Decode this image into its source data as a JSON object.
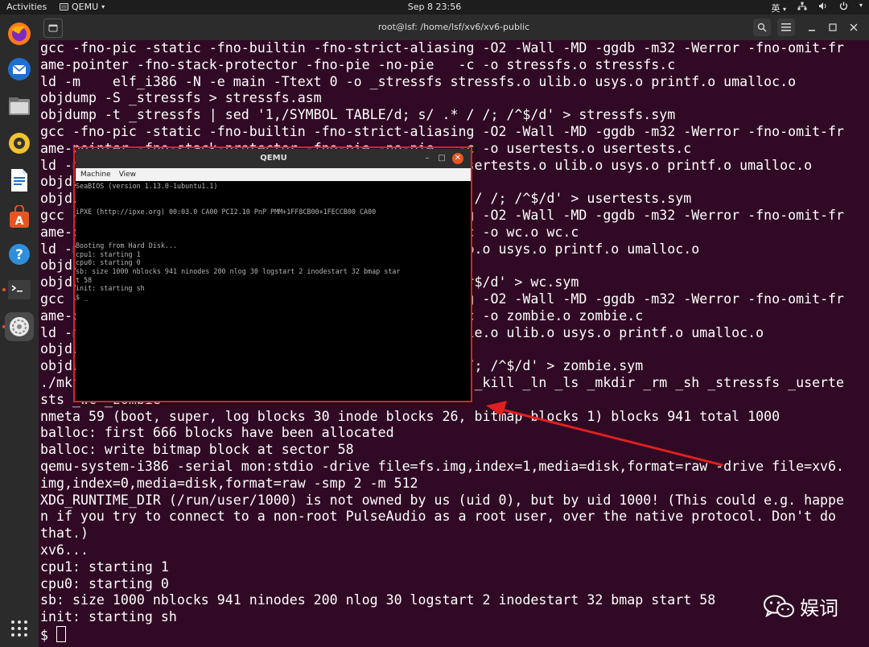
{
  "topbar": {
    "activities": "Activities",
    "app_name": "QEMU",
    "clock": "Sep 8  23:56",
    "input_method": "英"
  },
  "terminal": {
    "title": "root@lsf: /home/lsf/xv6/xv6-public",
    "lines": [
      "gcc -fno-pic -static -fno-builtin -fno-strict-aliasing -O2 -Wall -MD -ggdb -m32 -Werror -fno-omit-fr",
      "ame-pointer -fno-stack-protector -fno-pie -no-pie   -c -o stressfs.o stressfs.c",
      "ld -m    elf_i386 -N -e main -Ttext 0 -o _stressfs stressfs.o ulib.o usys.o printf.o umalloc.o",
      "objdump -S _stressfs > stressfs.asm",
      "objdump -t _stressfs | sed '1,/SYMBOL TABLE/d; s/ .* / /; /^$/d' > stressfs.sym",
      "gcc -fno-pic -static -fno-builtin -fno-strict-aliasing -O2 -Wall -MD -ggdb -m32 -Werror -fno-omit-fr",
      "ame-pointer -fno-stack-protector -fno-pie -no-pie   -c -o usertests.o usertests.c",
      "ld -m    elf_i386 -N -e main -Ttext 0 -o _usertests usertests.o ulib.o usys.o printf.o umalloc.o",
      "objdump -S _usertests > usertests.asm",
      "objdump -t _usertests | sed '1,/SYMBOL TABLE/d; s/ .* / /; /^$/d' > usertests.sym",
      "gcc -fno-pic -static -fno-builtin -fno-strict-aliasing -O2 -Wall -MD -ggdb -m32 -Werror -fno-omit-fr",
      "ame-pointer -fno-stack-protector -fno-pie -no-pie   -c -o wc.o wc.c",
      "ld -m    elf_i386 -N -e main -Ttext 0 -o _wc wc.o ulib.o usys.o printf.o umalloc.o",
      "objdump -S _wc > wc.asm",
      "objdump -t _wc | sed '1,/SYMBOL TABLE/d; s/ .* / /; /^$/d' > wc.sym",
      "gcc -fno-pic -static -fno-builtin -fno-strict-aliasing -O2 -Wall -MD -ggdb -m32 -Werror -fno-omit-fr",
      "ame-pointer -fno-stack-protector -fno-pie -no-pie   -c -o zombie.o zombie.c",
      "ld -m    elf_i386 -N -e main -Ttext 0 -o _zombie zombie.o ulib.o usys.o printf.o umalloc.o",
      "objdump -S _zombie > zombie.asm",
      "objdump -t _zombie | sed '1,/SYMBOL TABLE/d; s/ .* / /; /^$/d' > zombie.sym",
      "./mkfs fs.img README _cat _echo _forktest _grep _init _kill _ln _ls _mkdir _rm _sh _stressfs _userte",
      "sts _wc _zombie",
      "nmeta 59 (boot, super, log blocks 30 inode blocks 26, bitmap blocks 1) blocks 941 total 1000",
      "balloc: first 666 blocks have been allocated",
      "balloc: write bitmap block at sector 58",
      "qemu-system-i386 -serial mon:stdio -drive file=fs.img,index=1,media=disk,format=raw -drive file=xv6.",
      "img,index=0,media=disk,format=raw -smp 2 -m 512",
      "XDG_RUNTIME_DIR (/run/user/1000) is not owned by us (uid 0), but by uid 1000! (This could e.g. happe",
      "n if you try to connect to a non-root PulseAudio as a root user, over the native protocol. Don't do",
      "that.)",
      "xv6...",
      "cpu1: starting 1",
      "cpu0: starting 0",
      "sb: size 1000 nblocks 941 ninodes 200 nlog 30 logstart 2 inodestart 32 bmap start 58",
      "init: starting sh"
    ],
    "prompt": "$ "
  },
  "qemu": {
    "title": "QEMU",
    "menu": [
      "Machine",
      "View"
    ],
    "screen_lines": [
      "SeaBIOS (version 1.13.0-1ubuntu1.1)",
      "",
      "",
      "iPXE (http://ipxe.org) 00:03.0 CA00 PCI2.10 PnP PMM+1FF8CB00+1FECCB00 CA00",
      "",
      "",
      "",
      "Booting from Hard Disk...",
      "cpu1: starting 1",
      "cpu0: starting 0",
      "sb: size 1000 nblocks 941 ninodes 200 nlog 30 logstart 2 inodestart 32 bmap star",
      "t 58",
      "init: starting sh",
      "$ _"
    ]
  },
  "watermark": {
    "text": "娱词"
  },
  "colors": {
    "terminal_bg": "#300a24",
    "highlight_red": "#e02020",
    "ubuntu_orange": "#e95420"
  }
}
